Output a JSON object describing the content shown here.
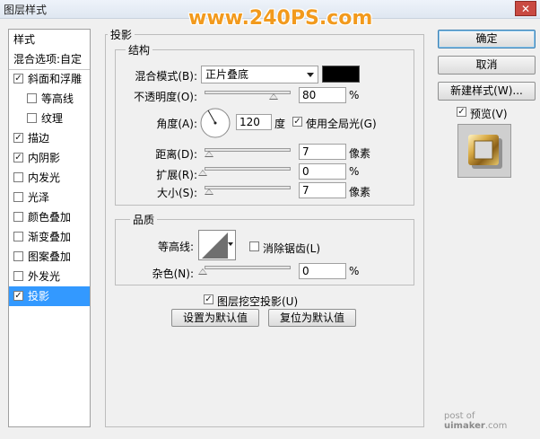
{
  "window": {
    "title": "图层样式",
    "close": "✕"
  },
  "watermark": "www.240PS.com",
  "left": {
    "header": "样式",
    "blend_options": "混合选项:自定",
    "items": [
      {
        "label": "斜面和浮雕",
        "checked": true,
        "indent": false
      },
      {
        "label": "等高线",
        "checked": false,
        "indent": true
      },
      {
        "label": "纹理",
        "checked": false,
        "indent": true
      },
      {
        "label": "描边",
        "checked": true,
        "indent": false
      },
      {
        "label": "内阴影",
        "checked": true,
        "indent": false
      },
      {
        "label": "内发光",
        "checked": false,
        "indent": false
      },
      {
        "label": "光泽",
        "checked": false,
        "indent": false
      },
      {
        "label": "颜色叠加",
        "checked": false,
        "indent": false
      },
      {
        "label": "渐变叠加",
        "checked": false,
        "indent": false
      },
      {
        "label": "图案叠加",
        "checked": false,
        "indent": false
      },
      {
        "label": "外发光",
        "checked": false,
        "indent": false
      },
      {
        "label": "投影",
        "checked": true,
        "indent": false,
        "selected": true
      }
    ]
  },
  "main": {
    "section_title": "投影",
    "structure": {
      "title": "结构",
      "blend_mode_label": "混合模式(B):",
      "blend_mode_value": "正片叠底",
      "shadow_color": "#000000",
      "opacity_label": "不透明度(O):",
      "opacity_value": "80",
      "opacity_unit": "%",
      "opacity_level": 0.8,
      "angle_label": "角度(A):",
      "angle_value": "120",
      "angle_unit": "度",
      "global_light_label": "使用全局光(G)",
      "global_light_checked": true,
      "distance_label": "距离(D):",
      "distance_value": "7",
      "distance_unit": "像素",
      "spread_label": "扩展(R):",
      "spread_value": "0",
      "spread_unit": "%",
      "size_label": "大小(S):",
      "size_value": "7",
      "size_unit": "像素"
    },
    "quality": {
      "title": "品质",
      "contour_label": "等高线:",
      "antialias_label": "消除锯齿(L)",
      "antialias_checked": false,
      "noise_label": "杂色(N):",
      "noise_value": "0",
      "noise_unit": "%"
    },
    "knockout_label": "图层挖空投影(U)",
    "knockout_checked": true,
    "set_default": "设置为默认值",
    "reset_default": "复位为默认值"
  },
  "right": {
    "ok": "确定",
    "cancel": "取消",
    "new_style": "新建样式(W)...",
    "preview_label": "预览(V)",
    "preview_checked": true
  },
  "footer_watermark": {
    "prefix": "post of ",
    "site": "uimaker",
    "suffix": ".com"
  },
  "colors": {
    "selection": "#3399ff",
    "watermark": "#f29a1d"
  }
}
